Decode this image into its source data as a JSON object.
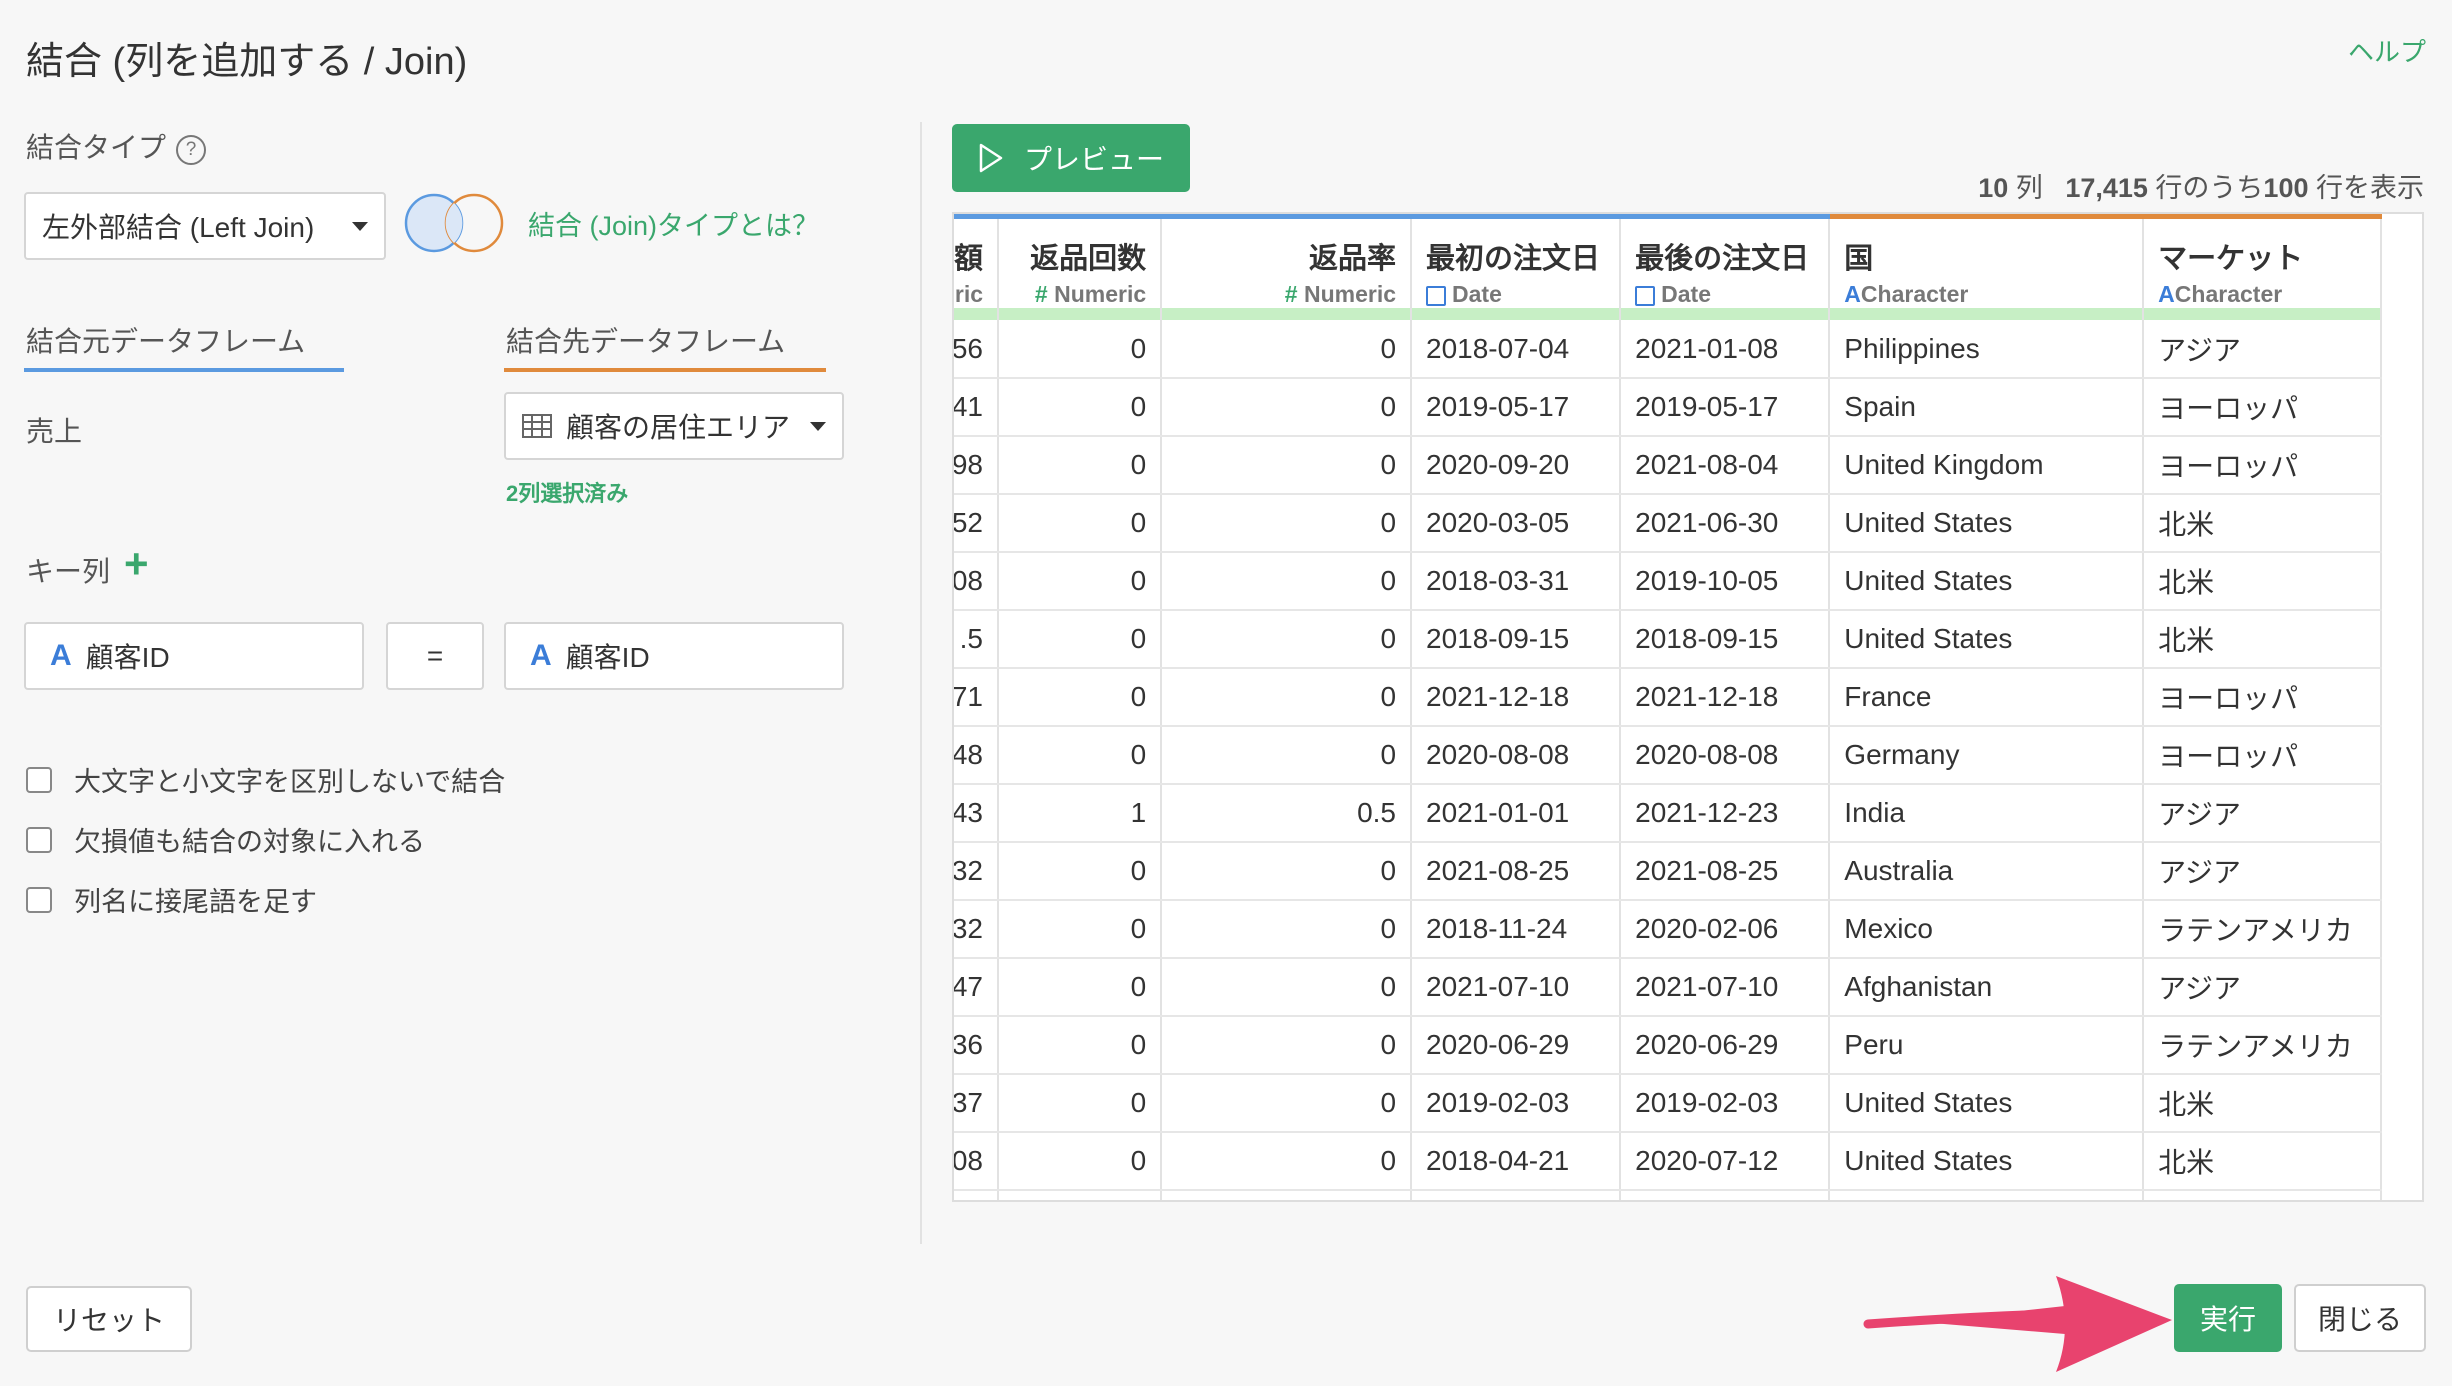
{
  "title": "結合 (列を追加する / Join)",
  "help": "ヘルプ",
  "join_type": {
    "label": "結合タイプ",
    "help_icon": "?",
    "selected": "左外部結合 (Left Join)",
    "info_link": "結合 (Join)タイプとは？"
  },
  "source": {
    "label": "結合元データフレーム",
    "value": "売上"
  },
  "target": {
    "label": "結合先データフレーム",
    "selected": "顧客の居住エリア",
    "selected_count": "2列選択済み"
  },
  "keys": {
    "label": "キー列",
    "add_icon": "+",
    "left": "顧客ID",
    "op": "=",
    "right": "顧客ID",
    "type_icon": "A"
  },
  "options": [
    "大文字と小文字を区別しないで結合",
    "欠損値も結合の対象に入れる",
    "列名に接尾語を足す"
  ],
  "preview": {
    "button": "プレビュー",
    "summary": {
      "cols": "10",
      "cols_unit": "列",
      "rows": "17,415",
      "rows_mid": "行のうち",
      "shown": "100",
      "shown_unit": "行を表示"
    }
  },
  "table": {
    "columns": [
      {
        "name": "額",
        "type": "ric"
      },
      {
        "name": "返品回数",
        "type": "Numeric",
        "type_icon": "#"
      },
      {
        "name": "返品率",
        "type": "Numeric",
        "type_icon": "#"
      },
      {
        "name": "最初の注文日",
        "type": "Date"
      },
      {
        "name": "最後の注文日",
        "type": "Date"
      },
      {
        "name": "国",
        "type": "Character",
        "type_icon": "A"
      },
      {
        "name": "マーケット",
        "type": "Character",
        "type_icon": "A"
      }
    ],
    "rows": [
      [
        "56",
        "0",
        "0",
        "2018-07-04",
        "2021-01-08",
        "Philippines",
        "アジア"
      ],
      [
        "41",
        "0",
        "0",
        "2019-05-17",
        "2019-05-17",
        "Spain",
        "ヨーロッパ"
      ],
      [
        "98",
        "0",
        "0",
        "2020-09-20",
        "2021-08-04",
        "United Kingdom",
        "ヨーロッパ"
      ],
      [
        "52",
        "0",
        "0",
        "2020-03-05",
        "2021-06-30",
        "United States",
        "北米"
      ],
      [
        "08",
        "0",
        "0",
        "2018-03-31",
        "2019-10-05",
        "United States",
        "北米"
      ],
      [
        ".5",
        "0",
        "0",
        "2018-09-15",
        "2018-09-15",
        "United States",
        "北米"
      ],
      [
        "71",
        "0",
        "0",
        "2021-12-18",
        "2021-12-18",
        "France",
        "ヨーロッパ"
      ],
      [
        "48",
        "0",
        "0",
        "2020-08-08",
        "2020-08-08",
        "Germany",
        "ヨーロッパ"
      ],
      [
        "43",
        "1",
        "0.5",
        "2021-01-01",
        "2021-12-23",
        "India",
        "アジア"
      ],
      [
        "32",
        "0",
        "0",
        "2021-08-25",
        "2021-08-25",
        "Australia",
        "アジア"
      ],
      [
        "32",
        "0",
        "0",
        "2018-11-24",
        "2020-02-06",
        "Mexico",
        "ラテンアメリカ"
      ],
      [
        "47",
        "0",
        "0",
        "2021-07-10",
        "2021-07-10",
        "Afghanistan",
        "アジア"
      ],
      [
        "36",
        "0",
        "0",
        "2020-06-29",
        "2020-06-29",
        "Peru",
        "ラテンアメリカ"
      ],
      [
        "37",
        "0",
        "0",
        "2019-02-03",
        "2019-02-03",
        "United States",
        "北米"
      ],
      [
        "08",
        "0",
        "0",
        "2018-04-21",
        "2020-07-12",
        "United States",
        "北米"
      ]
    ]
  },
  "footer": {
    "reset": "リセット",
    "run": "実行",
    "close": "閉じる"
  },
  "colors": {
    "accent_green": "#3aa76d",
    "blue": "#5b9ae0",
    "orange": "#e08a3c",
    "arrow": "#e8436e"
  }
}
